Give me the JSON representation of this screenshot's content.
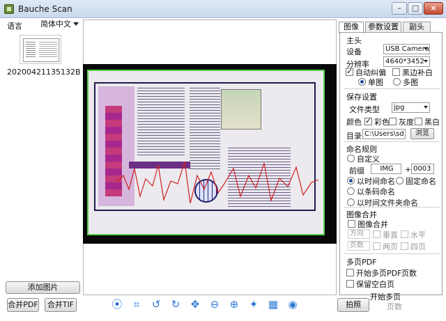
{
  "window": {
    "title": "Bauche Scan",
    "minimize": "–",
    "maximize": "□",
    "close": "×"
  },
  "left": {
    "language_label": "语言",
    "language_value": "简体中文",
    "thumbnail_label": "20200421135132B...",
    "add_image": "添加图片",
    "merge_pdf": "合并PDF",
    "merge_tif": "合并TIF"
  },
  "toolbar": {
    "icons": [
      "focus-icon",
      "crop-icon",
      "rotate-left-icon",
      "rotate-right-icon",
      "move-icon",
      "zoom-out-icon",
      "zoom-in-icon",
      "fit-icon",
      "film-icon",
      "record-icon"
    ],
    "glyphs": [
      "⦿",
      "⌗",
      "↺",
      "↻",
      "✥",
      "⊖",
      "⊕",
      "✦",
      "▦",
      "◉"
    ]
  },
  "tabs": [
    "图像",
    "参数设置",
    "副头"
  ],
  "panel": {
    "main_head": "主头",
    "device_label": "设备",
    "device_value": "USB Camera",
    "resolution_label": "分辨率",
    "resolution_value": "4640*3452",
    "auto_correct": "自动纠偏",
    "black_fill": "黑边补白",
    "single_page": "单图",
    "multi_page": "多图",
    "save_settings": "保存设置",
    "file_type_label": "文件类型",
    "file_type_value": "jpg",
    "color_label": "颜色",
    "color_option": "彩色",
    "gray_option": "灰度",
    "bw_option": "黑白",
    "dir_label": "目录",
    "dir_value": "C:\\Users\\sd",
    "browse": "浏览",
    "naming_rule": "命名规则",
    "custom": "自定义",
    "prefix_label": "前缀",
    "prefix_value": "IMG",
    "plus": "+",
    "counter_value": "0003",
    "by_time": "以时间命名",
    "fixed_name": "固定命名",
    "by_barcode": "以条码命名",
    "by_time_folder": "以时间文件夹命名",
    "image_merge": "图像合并",
    "image_merge_chk": "图像合并",
    "direction_label": "方向",
    "vertical": "垂直",
    "horizontal": "水平",
    "page_count_label": "页数",
    "two_pages": "两页",
    "four_pages": "四页",
    "multipage_pdf": "多页PDF",
    "start_multipage_pdf": "开始多页PDF",
    "pages_label": "页数",
    "keep_blank": "保留空白页",
    "start_multi": "开始多页",
    "pages_label2": "页数",
    "capture": "拍照"
  }
}
